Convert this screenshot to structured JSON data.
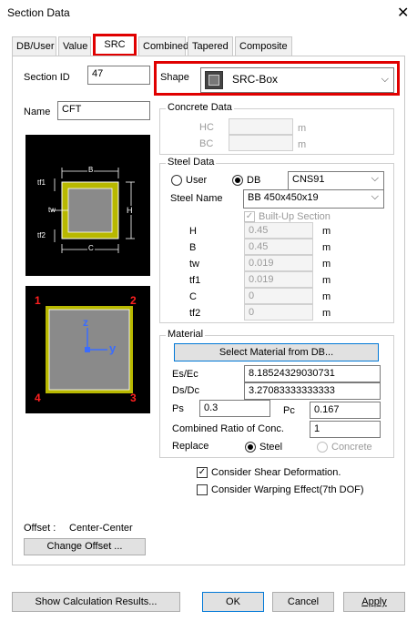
{
  "window": {
    "title": "Section Data",
    "close_glyph": "✕"
  },
  "tabs": [
    "DB/User",
    "Value",
    "SRC",
    "Combined",
    "Tapered",
    "Composite"
  ],
  "section": {
    "id_label": "Section ID",
    "id_value": "47",
    "name_label": "Name",
    "name_value": "CFT"
  },
  "shape": {
    "label": "Shape",
    "value": "SRC-Box"
  },
  "diagram1": {
    "dim_b": "B",
    "dim_h": "H",
    "dim_c": "C",
    "dim_tf1": "tf1",
    "dim_tw": "tw",
    "dim_tf2": "tf2"
  },
  "diagram2": {
    "corner1": "1",
    "corner2": "2",
    "corner3": "3",
    "corner4": "4",
    "axis_z": "z",
    "axis_y": "y"
  },
  "concrete": {
    "title": "Concrete Data",
    "hc_label": "HC",
    "bc_label": "BC",
    "unit": "m",
    "hc_value": "",
    "bc_value": ""
  },
  "steel": {
    "title": "Steel Data",
    "user_label": "User",
    "db_label": "DB",
    "db_value": "CNS91",
    "name_label": "Steel Name",
    "name_value": "BB 450x450x19",
    "builtup_label": "Built-Up Section",
    "unit": "m",
    "rows": [
      {
        "label": "H",
        "value": "0.45"
      },
      {
        "label": "B",
        "value": "0.45"
      },
      {
        "label": "tw",
        "value": "0.019"
      },
      {
        "label": "tf1",
        "value": "0.019"
      },
      {
        "label": "C",
        "value": "0"
      },
      {
        "label": "tf2",
        "value": "0"
      }
    ]
  },
  "material": {
    "title": "Material",
    "select_button": "Select Material from DB...",
    "es_label": "Es/Ec",
    "es_value": "8.18524329030731",
    "ds_label": "Ds/Dc",
    "ds_value": "3.27083333333333",
    "ps_label": "Ps",
    "ps_value": "0.3",
    "pc_label": "Pc",
    "pc_value": "0.167",
    "ratio_label": "Combined Ratio of Conc.",
    "ratio_value": "1",
    "replace_label": "Replace",
    "steel_label": "Steel",
    "concrete_label": "Concrete"
  },
  "options": {
    "shear_label": "Consider Shear Deformation.",
    "warping_label": "Consider Warping Effect(7th DOF)"
  },
  "offset": {
    "label": "Offset :",
    "value": "Center-Center",
    "button": "Change Offset ..."
  },
  "footer": {
    "show_calc": "Show Calculation Results...",
    "ok": "OK",
    "cancel": "Cancel",
    "apply": "Apply"
  },
  "colors": {
    "highlight": "#e00000",
    "steel_fill": "#b8b800",
    "concrete_fill": "#8a8a8a",
    "diagram_bg": "#000000"
  }
}
